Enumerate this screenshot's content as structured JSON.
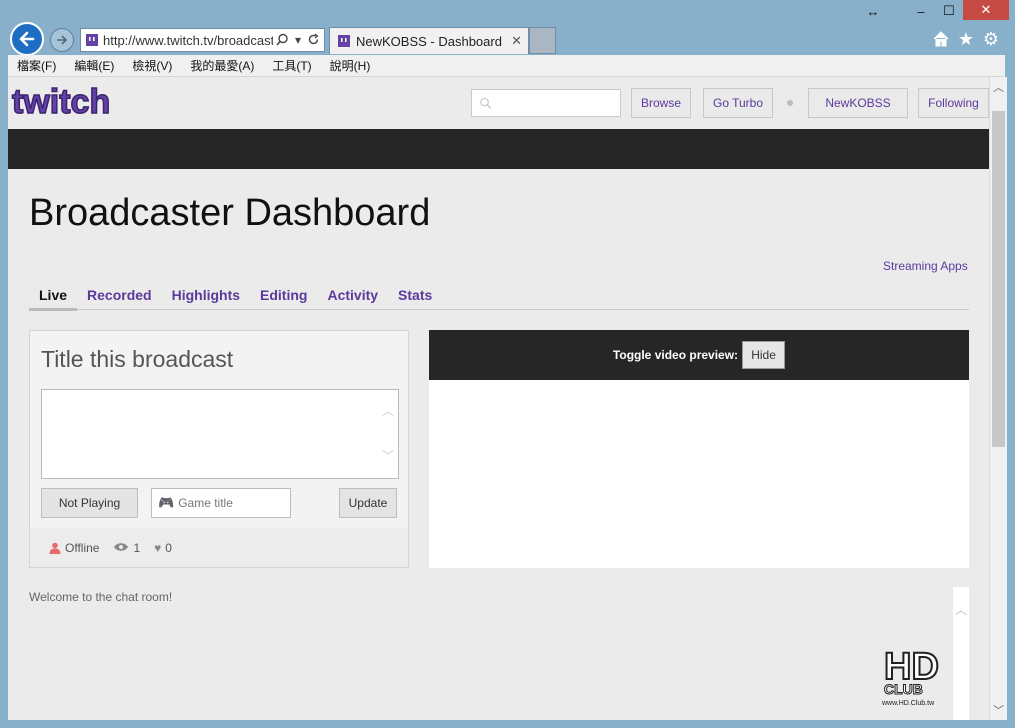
{
  "window": {
    "resize_glyph": "↔",
    "min_glyph": "–",
    "max_glyph": "☐",
    "close_glyph": "✕"
  },
  "browser": {
    "url": "http://www.twitch.tv/broadcast",
    "tab_title": "NewKOBSS - Dashboard",
    "tab_close": "✕",
    "icons": [
      "back-arrow-icon",
      "forward-arrow-icon",
      "search-icon",
      "refresh-icon",
      "home-icon",
      "star-icon",
      "gear-icon"
    ]
  },
  "menu": [
    "檔案(F)",
    "編輯(E)",
    "檢視(V)",
    "我的最愛(A)",
    "工具(T)",
    "說明(H)"
  ],
  "header": {
    "logo_text": "twitch",
    "search_placeholder": "",
    "browse": "Browse",
    "turbo": "Go Turbo",
    "user": "NewKOBSS",
    "following": "Following"
  },
  "dashboard": {
    "title": "Broadcaster Dashboard",
    "streaming_apps": "Streaming Apps",
    "tabs": [
      {
        "label": "Live",
        "active": true
      },
      {
        "label": "Recorded"
      },
      {
        "label": "Highlights"
      },
      {
        "label": "Editing"
      },
      {
        "label": "Activity"
      },
      {
        "label": "Stats"
      }
    ],
    "panel_title": "Title this broadcast",
    "textarea_value": "",
    "not_playing": "Not Playing",
    "game_placeholder": "Game title",
    "update": "Update",
    "status": "Offline",
    "viewers": "1",
    "hearts": "0",
    "toggle_label": "Toggle video preview:",
    "hide": "Hide",
    "chat_welcome": "Welcome to the chat room!"
  },
  "watermark": {
    "text": "HD",
    "subtext": "CLUB",
    "url": "www.HD.Club.tw"
  },
  "colors": {
    "twitch_purple": "#5a3a9c",
    "dark_bar": "#262626",
    "close_red": "#c74b45",
    "back_blue": "#1e6fc4"
  }
}
